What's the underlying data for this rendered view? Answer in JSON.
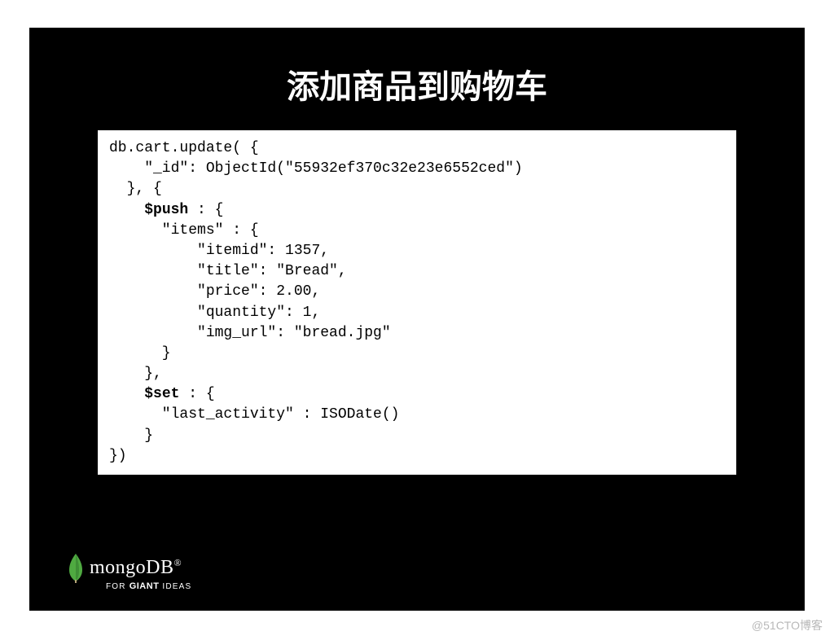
{
  "slide": {
    "title": "添加商品到购物车",
    "code": {
      "l1": "db.cart.update( {",
      "l2": "    \"_id\": ObjectId(\"55932ef370c32e23e6552ced\")",
      "l3": "  }, {",
      "l4a": "    ",
      "l4b": "$push",
      "l4c": " : {",
      "l5": "      \"items\" : {",
      "l6": "          \"itemid\": 1357,",
      "l7": "          \"title\": \"Bread\",",
      "l8": "          \"price\": 2.00,",
      "l9": "          \"quantity\": 1,",
      "l10": "          \"img_url\": \"bread.jpg\"",
      "l11": "      }",
      "l12": "    },",
      "l13a": "    ",
      "l13b": "$set",
      "l13c": " : {",
      "l14": "      \"last_activity\" : ISODate()",
      "l15": "    }",
      "l16": "})"
    }
  },
  "logo": {
    "brand": "mongoDB",
    "suffix": "®",
    "tagline_pre": "FOR ",
    "tagline_bold": "GIANT",
    "tagline_post": " IDEAS"
  },
  "watermark": "@51CTO博客"
}
